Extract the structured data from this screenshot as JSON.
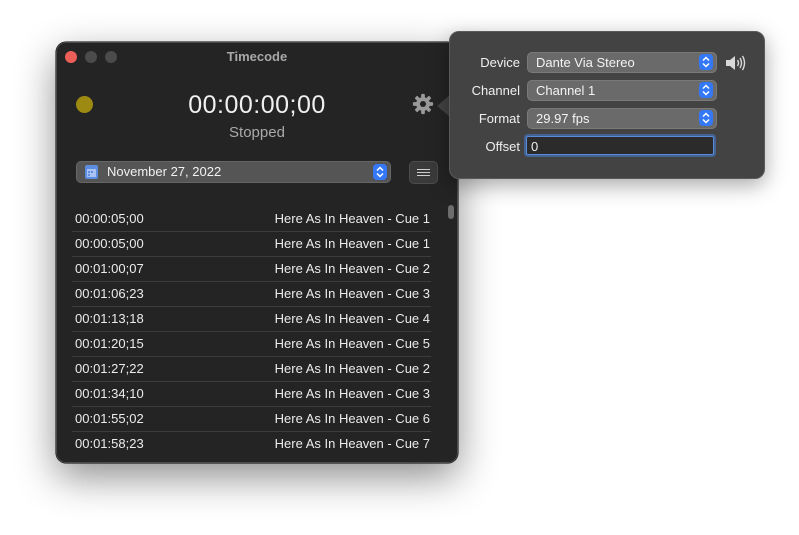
{
  "window": {
    "title": "Timecode",
    "clock": "00:00:00;00",
    "state": "Stopped",
    "date": "November 27, 2022"
  },
  "cues": [
    {
      "timecode": "00:00:05;00",
      "label": "Here As In Heaven - Cue 1"
    },
    {
      "timecode": "00:00:05;00",
      "label": "Here As In Heaven - Cue 1"
    },
    {
      "timecode": "00:01:00;07",
      "label": "Here As In Heaven - Cue 2"
    },
    {
      "timecode": "00:01:06;23",
      "label": "Here As In Heaven - Cue 3"
    },
    {
      "timecode": "00:01:13;18",
      "label": "Here As In Heaven - Cue 4"
    },
    {
      "timecode": "00:01:20;15",
      "label": "Here As In Heaven - Cue 5"
    },
    {
      "timecode": "00:01:27;22",
      "label": "Here As In Heaven - Cue 2"
    },
    {
      "timecode": "00:01:34;10",
      "label": "Here As In Heaven - Cue 3"
    },
    {
      "timecode": "00:01:55;02",
      "label": "Here As In Heaven - Cue 6"
    },
    {
      "timecode": "00:01:58;23",
      "label": "Here As In Heaven - Cue 7"
    }
  ],
  "settings": {
    "device_label": "Device",
    "device_value": "Dante Via Stereo",
    "channel_label": "Channel",
    "channel_value": "Channel 1",
    "format_label": "Format",
    "format_value": "29.97 fps",
    "offset_label": "Offset",
    "offset_value": "0"
  },
  "icons": {
    "status": "status-dot-icon",
    "settings": "gear-icon",
    "calendar": "calendar-icon",
    "list": "list-icon",
    "speaker": "speaker-icon"
  },
  "colors": {
    "accent": "#3478f6",
    "status_dot": "#9c8a12",
    "close": "#ec5f59"
  }
}
